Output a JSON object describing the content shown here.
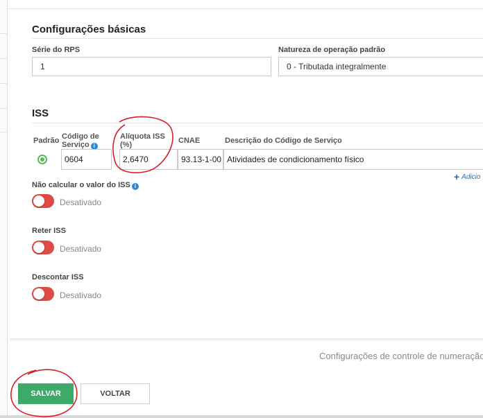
{
  "basic": {
    "title": "Configurações básicas",
    "rps_label": "Série do RPS",
    "rps_value": "1",
    "nature_label": "Natureza de operação padrão",
    "nature_value": "0 - Tributada integralmente"
  },
  "iss": {
    "title": "ISS",
    "headers": {
      "default": "Padrão",
      "code_line1": "Código de",
      "code_line2": "Serviço",
      "rate_line1": "Alíquota ISS",
      "rate_line2": "(%)",
      "cnae": "CNAE",
      "description": "Descrição do Código de Serviço"
    },
    "row": {
      "code": "0604",
      "rate": "2,6470",
      "cnae": "93.13-1-00",
      "description": "Atividades de condicionamento físico"
    },
    "add_link": "Adicio"
  },
  "toggles": [
    {
      "label": "Não calcular o valor do ISS",
      "state": "Desativado"
    },
    {
      "label": "Reter ISS",
      "state": "Desativado"
    },
    {
      "label": "Descontar ISS",
      "state": "Desativado"
    }
  ],
  "footer": {
    "config_link": "Configurações de controle de numeração",
    "save": "SALVAR",
    "back": "VOLTAR"
  },
  "colors": {
    "accent_green": "#3eaa6a",
    "toggle_off": "#e04a44",
    "info_blue": "#2f86d2",
    "annotation_red": "#d41f26"
  },
  "icons": [
    "info-icon",
    "plus-icon",
    "radio-selected-icon"
  ]
}
